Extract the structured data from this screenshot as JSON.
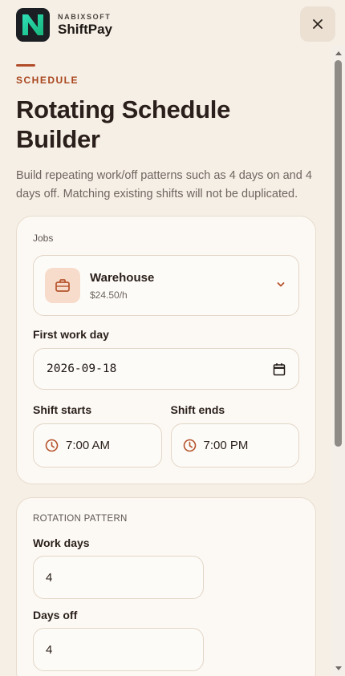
{
  "brand": {
    "company": "NABIXSOFT",
    "name": "ShiftPay",
    "logo_letter": "N",
    "logo_colors": {
      "bg": "#1b1e22",
      "start": "#2ee0b8",
      "end": "#17b57a"
    }
  },
  "header": {
    "close_icon": "close-icon"
  },
  "page": {
    "eyebrow": "SCHEDULE",
    "title": "Rotating Schedule Builder",
    "description": "Build repeating work/off patterns such as 4 days on and 4 days off. Matching existing shifts will not be duplicated."
  },
  "job_card": {
    "jobs_label": "Jobs",
    "selected_job": {
      "name": "Warehouse",
      "rate": "$24.50/h",
      "icon": "briefcase-icon"
    },
    "first_work_day_label": "First work day",
    "first_work_day_value": "2026-09-18",
    "shift_starts_label": "Shift starts",
    "shift_starts_value": "7:00 AM",
    "shift_ends_label": "Shift ends",
    "shift_ends_value": "7:00 PM"
  },
  "rotation_card": {
    "section_label": "ROTATION PATTERN",
    "work_days_label": "Work days",
    "work_days_value": "4",
    "days_off_label": "Days off",
    "days_off_value": "4"
  },
  "colors": {
    "accent": "#a9461f",
    "background": "#f6efe6",
    "card": "#fcf9f4",
    "icon_tint": "#b5532d"
  }
}
